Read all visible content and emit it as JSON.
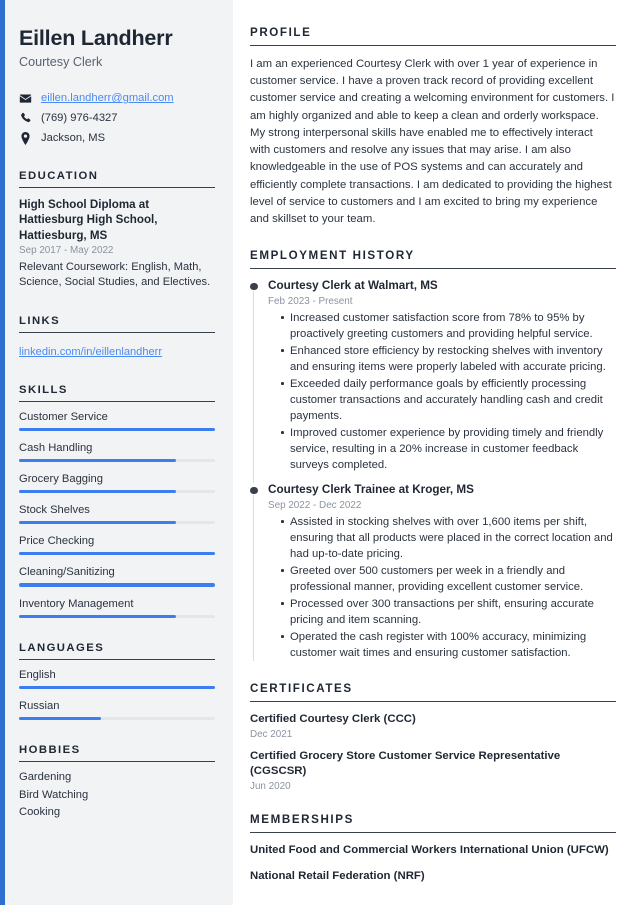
{
  "theme": {
    "accent": "#2f6fd0",
    "bar_fill": "#3c7ef0",
    "bar_track": "#e4e7ea",
    "sidebar_bg": "#f1f3f5",
    "heading": "#1f2733",
    "muted": "#8b93a1",
    "link": "#4a8af4"
  },
  "sidebar": {
    "name": "Eillen Landherr",
    "job_title": "Courtesy Clerk",
    "contact": [
      {
        "icon": "envelope-icon",
        "text": "eillen.landherr@gmail.com",
        "is_link": true
      },
      {
        "icon": "phone-icon",
        "text": "(769) 976-4327",
        "is_link": false
      },
      {
        "icon": "location-pin-icon",
        "text": "Jackson, MS",
        "is_link": false
      }
    ],
    "education": {
      "heading": "EDUCATION",
      "degree": "High School Diploma at Hattiesburg High School, Hattiesburg, MS",
      "date": "Sep 2017 - May 2022",
      "description": "Relevant Coursework: English, Math, Science, Social Studies, and Electives."
    },
    "links": {
      "heading": "LINKS",
      "items": [
        {
          "label": "linkedin.com/in/eillenlandherr"
        }
      ]
    },
    "skills": {
      "heading": "SKILLS",
      "items": [
        {
          "label": "Customer Service",
          "level": 100
        },
        {
          "label": "Cash Handling",
          "level": 80
        },
        {
          "label": "Grocery Bagging",
          "level": 80
        },
        {
          "label": "Stock Shelves",
          "level": 80
        },
        {
          "label": "Price Checking",
          "level": 100
        },
        {
          "label": "Cleaning/Sanitizing",
          "level": 100
        },
        {
          "label": "Inventory Management",
          "level": 80
        }
      ]
    },
    "languages": {
      "heading": "LANGUAGES",
      "items": [
        {
          "label": "English",
          "level": 100
        },
        {
          "label": "Russian",
          "level": 42
        }
      ]
    },
    "hobbies": {
      "heading": "HOBBIES",
      "items": [
        {
          "label": "Gardening"
        },
        {
          "label": "Bird Watching"
        },
        {
          "label": "Cooking"
        }
      ]
    }
  },
  "main": {
    "profile": {
      "heading": "PROFILE",
      "text": "I am an experienced Courtesy Clerk with over 1 year of experience in customer service. I have a proven track record of providing excellent customer service and creating a welcoming environment for customers. I am highly organized and able to keep a clean and orderly workspace. My strong interpersonal skills have enabled me to effectively interact with customers and resolve any issues that may arise. I am also knowledgeable in the use of POS systems and can accurately and efficiently complete transactions. I am dedicated to providing the highest level of service to customers and I am excited to bring my experience and skillset to your team."
    },
    "employment": {
      "heading": "EMPLOYMENT HISTORY",
      "jobs": [
        {
          "role": "Courtesy Clerk at Walmart, MS",
          "date": "Feb 2023 - Present",
          "points": [
            "Increased customer satisfaction score from 78% to 95% by proactively greeting customers and providing helpful service.",
            "Enhanced store efficiency by restocking shelves with inventory and ensuring items were properly labeled with accurate pricing.",
            "Exceeded daily performance goals by efficiently processing customer transactions and accurately handling cash and credit payments.",
            "Improved customer experience by providing timely and friendly service, resulting in a 20% increase in customer feedback surveys completed."
          ]
        },
        {
          "role": "Courtesy Clerk Trainee at Kroger, MS",
          "date": "Sep 2022 - Dec 2022",
          "points": [
            "Assisted in stocking shelves with over 1,600 items per shift, ensuring that all products were placed in the correct location and had up-to-date pricing.",
            "Greeted over 500 customers per week in a friendly and professional manner, providing excellent customer service.",
            "Processed over 300 transactions per shift, ensuring accurate pricing and item scanning.",
            "Operated the cash register with 100% accuracy, minimizing customer wait times and ensuring customer satisfaction."
          ]
        }
      ]
    },
    "certificates": {
      "heading": "CERTIFICATES",
      "items": [
        {
          "title": "Certified Courtesy Clerk (CCC)",
          "date": "Dec 2021"
        },
        {
          "title": "Certified Grocery Store Customer Service Representative (CGSCSR)",
          "date": "Jun 2020"
        }
      ]
    },
    "memberships": {
      "heading": "MEMBERSHIPS",
      "items": [
        {
          "title": "United Food and Commercial Workers International Union (UFCW)"
        },
        {
          "title": "National Retail Federation (NRF)"
        }
      ]
    }
  }
}
